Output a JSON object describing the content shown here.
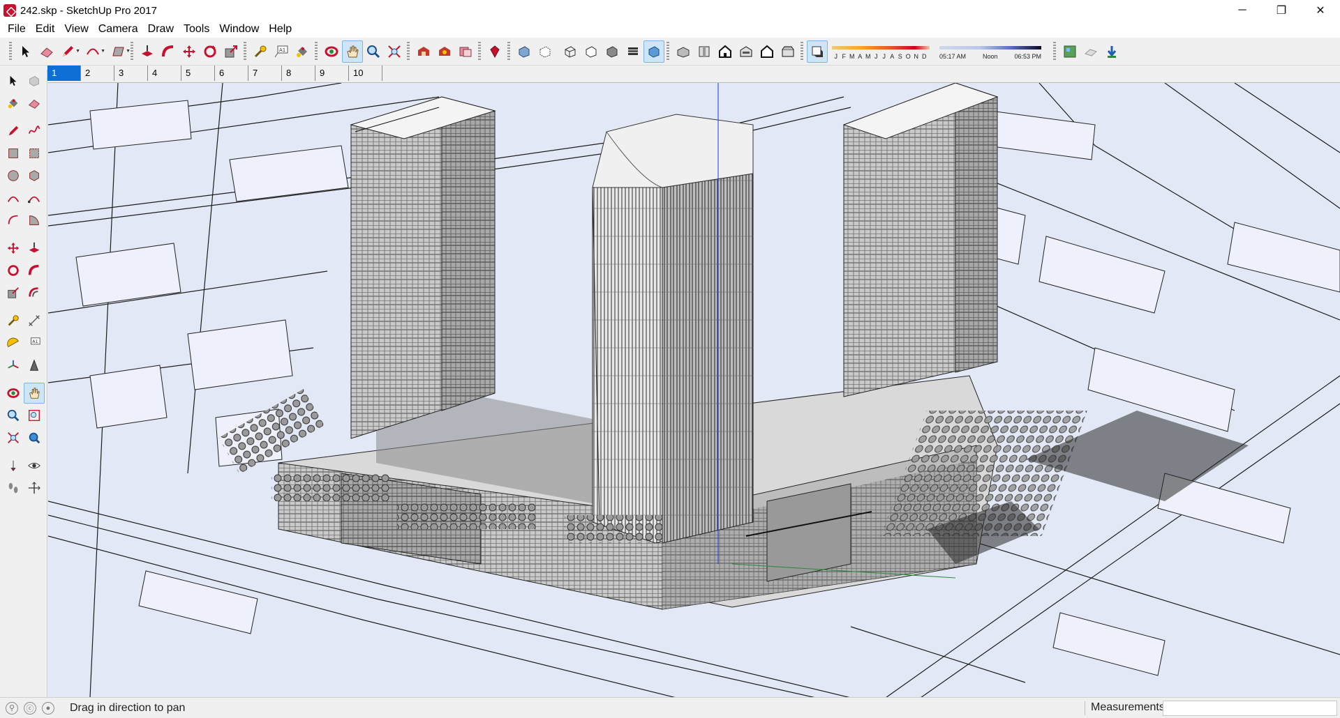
{
  "window": {
    "title": "242.skp - SketchUp Pro 2017",
    "min": "─",
    "max": "❐",
    "close": "✕"
  },
  "menu": [
    "File",
    "Edit",
    "View",
    "Camera",
    "Draw",
    "Tools",
    "Window",
    "Help"
  ],
  "shadow": {
    "months": [
      "J",
      "F",
      "M",
      "A",
      "M",
      "J",
      "J",
      "A",
      "S",
      "O",
      "N",
      "D"
    ],
    "time_start": "05:17 AM",
    "time_mid": "Noon",
    "time_end": "06:53 PM",
    "month_color_left": "#f5a623",
    "month_color_right": "#d0021b",
    "time_color": "#1f3a93"
  },
  "scenes": [
    "1",
    "2",
    "3",
    "4",
    "5",
    "6",
    "7",
    "8",
    "9",
    "10"
  ],
  "status": {
    "hint": "Drag in direction to pan",
    "measurements_label": "Measurements",
    "measurements_value": ""
  },
  "icons": {
    "toolbar": [
      "select-icon",
      "eraser-icon",
      "pencil-icon",
      "arc-icon",
      "rectangle-icon",
      "push-pull-icon",
      "follow-me-icon",
      "move-icon",
      "rotate-icon",
      "scale-icon",
      "tape-measure-icon",
      "text-icon",
      "paint-bucket-icon",
      "orbit-icon",
      "pan-icon",
      "zoom-icon",
      "zoom-extents-icon",
      "warehouse-icon",
      "extension-warehouse-icon",
      "send-to-layout-icon",
      "ruby-icon",
      "xray-icon",
      "back-edges-icon",
      "wireframe-icon",
      "hidden-line-icon",
      "shaded-icon",
      "shaded-textures-icon",
      "monochrome-icon",
      "iso-view-icon",
      "top-view-icon",
      "front-view-icon",
      "right-view-icon",
      "back-view-icon",
      "left-view-icon",
      "shadows-toggle-icon",
      "add-location-icon",
      "toggle-terrain-icon",
      "photo-textures-icon"
    ]
  },
  "colors": {
    "accent": "#0d6fd6",
    "viewport": "#e3e8f6",
    "active_tool": "#cde6f7"
  }
}
